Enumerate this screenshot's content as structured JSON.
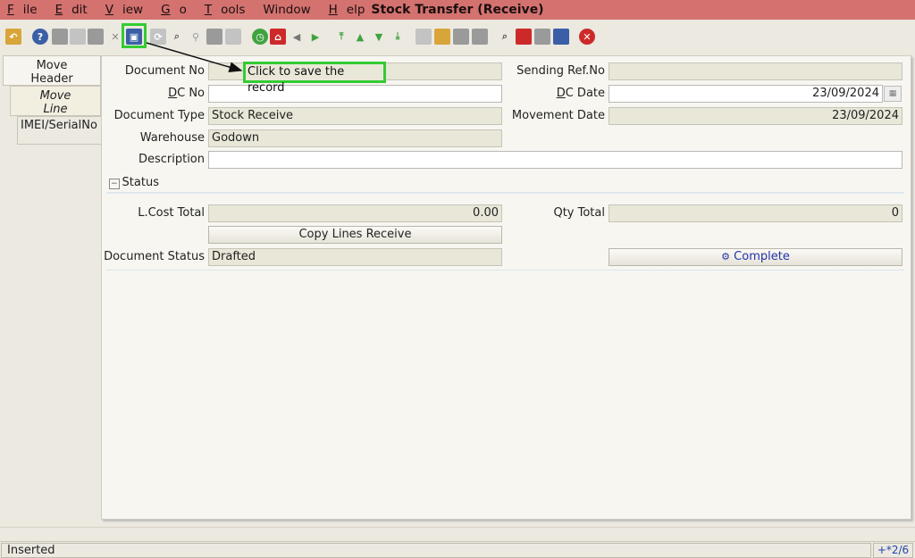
{
  "menu": [
    {
      "u": "F",
      "rest": "ile"
    },
    {
      "u": "E",
      "rest": "dit"
    },
    {
      "u": "V",
      "rest": "iew"
    },
    {
      "u": "G",
      "rest": "o"
    },
    {
      "u": "T",
      "rest": "ools"
    },
    {
      "u": "",
      "rest": "Window"
    },
    {
      "u": "H",
      "rest": "elp"
    }
  ],
  "window_title": "Stock Transfer (Receive)",
  "tabs": {
    "header_line1": "Move",
    "header_line2": "Header",
    "line_line1": "Move",
    "line_line2": "Line",
    "imei": "IMEI/SerialNo"
  },
  "form": {
    "document_no_label": "Document No",
    "sending_ref_label": "Sending Ref.No",
    "dc_no_label_u": "D",
    "dc_no_label_rest": "C No",
    "dc_date_label_u": "D",
    "dc_date_label_rest": "C Date",
    "dc_date_value": "23/09/2024",
    "document_type_label": "Document Type",
    "document_type_value": "Stock Receive",
    "movement_date_label": "Movement Date",
    "movement_date_value": "23/09/2024",
    "warehouse_label": "Warehouse",
    "warehouse_value": "Godown",
    "description_label": "Description",
    "status_section": "Status",
    "lcost_total_label": "L.Cost Total",
    "lcost_total_value": "0.00",
    "qty_total_label": "Qty Total",
    "qty_total_value": "0",
    "copy_lines_button": "Copy Lines Receive",
    "document_status_label": "Document Status",
    "document_status_value": "Drafted",
    "complete_button": "Complete"
  },
  "callout": "Click to save the record",
  "status": {
    "message": "Inserted",
    "record_nav": "+*2/6"
  },
  "colors": {
    "titlebar": "#d4726f",
    "highlight": "#33cc33",
    "readonly_field": "#e9e7d8"
  }
}
